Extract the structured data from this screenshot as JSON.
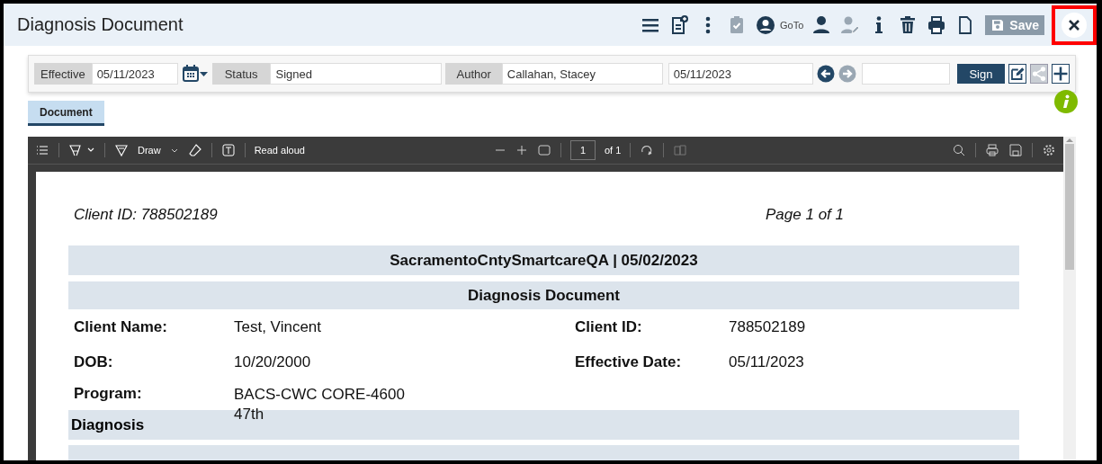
{
  "window": {
    "title": "Diagnosis Document",
    "goto_label": "GoTo",
    "save_label": "Save",
    "close_highlighted": true
  },
  "header_icons": [
    {
      "kind": "menu",
      "disabled": false
    },
    {
      "kind": "add-note",
      "disabled": false
    },
    {
      "kind": "more",
      "disabled": false
    },
    {
      "kind": "clipboard",
      "disabled": true
    },
    {
      "kind": "user-circle",
      "disabled": false
    }
  ],
  "header_icons_2": [
    {
      "kind": "user",
      "disabled": false
    },
    {
      "kind": "user-edit",
      "disabled": true
    },
    {
      "kind": "info",
      "disabled": false
    },
    {
      "kind": "trash",
      "disabled": false
    },
    {
      "kind": "print",
      "disabled": false
    },
    {
      "kind": "page",
      "disabled": false
    }
  ],
  "form": {
    "effective": {
      "label": "Effective",
      "value": "05/11/2023"
    },
    "status": {
      "label": "Status",
      "value": "Signed"
    },
    "author": {
      "label": "Author",
      "value": "Callahan, Stacey"
    },
    "date": {
      "value": "05/11/2023"
    },
    "prev_disabled": false,
    "next_disabled": true,
    "sign_label": "Sign",
    "share_disabled": true
  },
  "tabs": [
    {
      "label": "Document",
      "selected": true
    }
  ],
  "viewer": {
    "draw_label": "Draw",
    "read_aloud_label": "Read aloud",
    "page_input": "1",
    "page_count": "of 1"
  },
  "document": {
    "client_id_line": "Client ID: 788502189",
    "page_line": "Page 1 of 1",
    "banners": [
      "SacramentoCntySmartcareQA | 05/02/2023",
      "Diagnosis Document"
    ],
    "fields": [
      {
        "label": "Client Name:",
        "value": "Test, Vincent",
        "label_2": "Client ID:",
        "value_2": "788502189"
      },
      {
        "label": "DOB:",
        "value": "10/20/2000",
        "label_2": "Effective Date:",
        "value_2": "05/11/2023"
      },
      {
        "label": "Program:",
        "value": "BACS-CWC CORE-4600 47th"
      }
    ],
    "section": "Diagnosis"
  }
}
